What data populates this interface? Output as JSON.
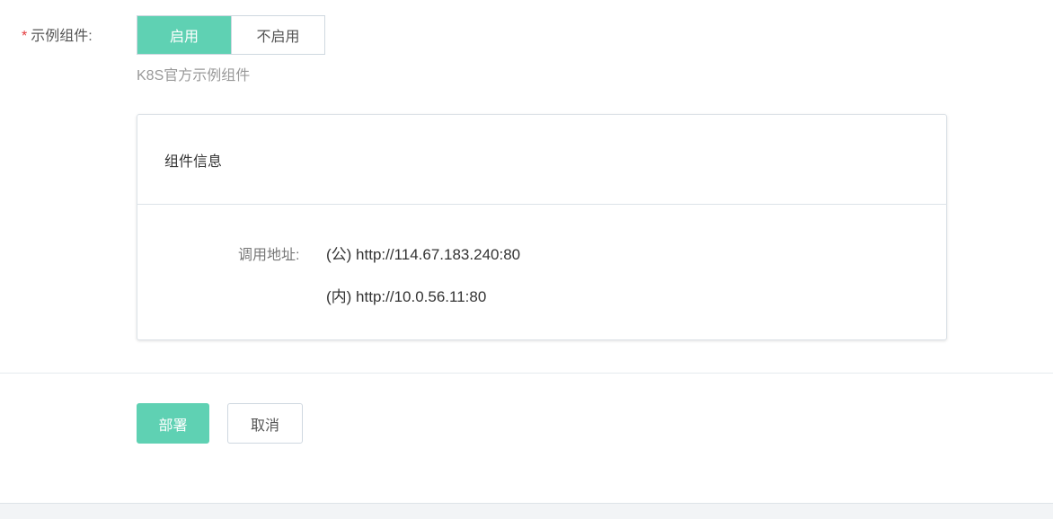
{
  "form": {
    "required_mark": "*",
    "field_label": "示例组件:",
    "toggle": {
      "options": [
        "启用",
        "不启用"
      ],
      "selected": "启用"
    },
    "hint": "K8S官方示例组件"
  },
  "card": {
    "title": "组件信息",
    "address_label": "调用地址:",
    "address_public": "(公) http://114.67.183.240:80",
    "address_internal": "(内) http://10.0.56.11:80"
  },
  "actions": {
    "deploy_label": "部署",
    "cancel_label": "取消"
  },
  "colors": {
    "accent": "#5fd1b3",
    "required": "#e4393c"
  }
}
